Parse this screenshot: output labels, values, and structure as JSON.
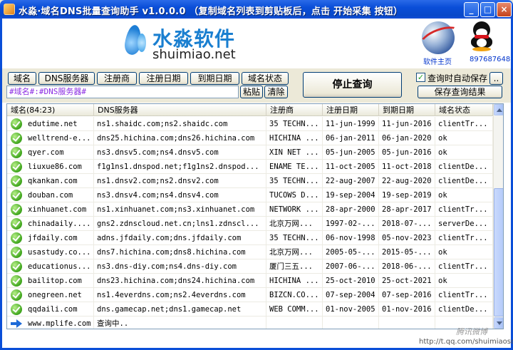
{
  "window": {
    "title": "水淼·域名DNS批量查询助手 v1.0.0.0   （复制域名列表到剪贴板后，点击 开始采集 按钮）",
    "min_label": "_",
    "max_label": "□",
    "close_label": "×"
  },
  "header": {
    "logo_cn": "水淼软件",
    "logo_en": "shuimiao.net",
    "home_label": "软件主页",
    "qq_label": "897687648"
  },
  "fields": [
    "域名",
    "DNS服务器",
    "注册商",
    "注册日期",
    "到期日期",
    "域名状态"
  ],
  "format_input": "#域名#:#DNS服务器#",
  "paste_label": "粘贴",
  "clear_label": "清除",
  "stop_label": "停止查询",
  "autosave_label": "查询时自动保存",
  "autosave_checked": true,
  "more_label": "..",
  "save_results_label": "保存查询结果",
  "table": {
    "columns": [
      "域名(84:23)",
      "DNS服务器",
      "注册商",
      "注册日期",
      "到期日期",
      "域名状态"
    ],
    "rows": [
      {
        "status": "ok",
        "domain": "edutime.net",
        "dns": "ns1.shaidc.com;ns2.shaidc.com",
        "registrar": "35 TECHN...",
        "reg_date": "11-jun-1999",
        "exp_date": "11-jun-2016",
        "state": "clientTr..."
      },
      {
        "status": "ok",
        "domain": "welltrend-e...",
        "dns": "dns25.hichina.com;dns26.hichina.com",
        "registrar": "HICHINA ...",
        "reg_date": "06-jan-2011",
        "exp_date": "06-jan-2020",
        "state": "ok"
      },
      {
        "status": "ok",
        "domain": "qyer.com",
        "dns": "ns3.dnsv5.com;ns4.dnsv5.com",
        "registrar": "XIN NET ...",
        "reg_date": "05-jun-2005",
        "exp_date": "05-jun-2016",
        "state": "ok"
      },
      {
        "status": "ok",
        "domain": "liuxue86.com",
        "dns": "f1g1ns1.dnspod.net;f1g1ns2.dnspod...",
        "registrar": "ENAME TE...",
        "reg_date": "11-oct-2005",
        "exp_date": "11-oct-2018",
        "state": "clientDe..."
      },
      {
        "status": "ok",
        "domain": "qkankan.com",
        "dns": "ns1.dnsv2.com;ns2.dnsv2.com",
        "registrar": "35 TECHN...",
        "reg_date": "22-aug-2007",
        "exp_date": "22-aug-2020",
        "state": "clientDe..."
      },
      {
        "status": "ok",
        "domain": "douban.com",
        "dns": "ns3.dnsv4.com;ns4.dnsv4.com",
        "registrar": "TUCOWS D...",
        "reg_date": "19-sep-2004",
        "exp_date": "19-sep-2019",
        "state": "ok"
      },
      {
        "status": "ok",
        "domain": "xinhuanet.com",
        "dns": "ns1.xinhuanet.com;ns3.xinhuanet.com",
        "registrar": "NETWORK ...",
        "reg_date": "28-apr-2000",
        "exp_date": "28-apr-2017",
        "state": "clientTr..."
      },
      {
        "status": "ok",
        "domain": "chinadaily....",
        "dns": "gns2.zdnscloud.net.cn;lns1.zdnscl...",
        "registrar": "北京万网...",
        "reg_date": "1997-02-...",
        "exp_date": "2018-07-...",
        "state": "serverDe..."
      },
      {
        "status": "ok",
        "domain": "jfdaily.com",
        "dns": "adns.jfdaily.com;dns.jfdaily.com",
        "registrar": "35 TECHN...",
        "reg_date": "06-nov-1998",
        "exp_date": "05-nov-2023",
        "state": "clientTr..."
      },
      {
        "status": "ok",
        "domain": "usastudy.co...",
        "dns": "dns7.hichina.com;dns8.hichina.com",
        "registrar": "北京万网...",
        "reg_date": "2005-05-...",
        "exp_date": "2015-05-...",
        "state": "ok"
      },
      {
        "status": "ok",
        "domain": "educationus...",
        "dns": "ns3.dns-diy.com;ns4.dns-diy.com",
        "registrar": "厦门三五...",
        "reg_date": "2007-06-...",
        "exp_date": "2018-06-...",
        "state": "clientTr..."
      },
      {
        "status": "ok",
        "domain": "bailitop.com",
        "dns": "dns23.hichina.com;dns24.hichina.com",
        "registrar": "HICHINA ...",
        "reg_date": "25-oct-2010",
        "exp_date": "25-oct-2021",
        "state": "ok"
      },
      {
        "status": "ok",
        "domain": "onegreen.net",
        "dns": "ns1.4everdns.com;ns2.4everdns.com",
        "registrar": "BIZCN.CO...",
        "reg_date": "07-sep-2004",
        "exp_date": "07-sep-2016",
        "state": "clientTr..."
      },
      {
        "status": "ok",
        "domain": "qqdaili.com",
        "dns": "dns.gamecap.net;dns1.gamecap.net",
        "registrar": "WEB COMM...",
        "reg_date": "01-nov-2005",
        "exp_date": "01-nov-2016",
        "state": "clientDe..."
      },
      {
        "status": "pending",
        "domain": "www.mplife.com",
        "dns": "查询中..",
        "registrar": "",
        "reg_date": "",
        "exp_date": "",
        "state": ""
      }
    ]
  },
  "watermark": "腾讯微博",
  "watermark_url": "http://t.qq.com/shuimiaosoft"
}
